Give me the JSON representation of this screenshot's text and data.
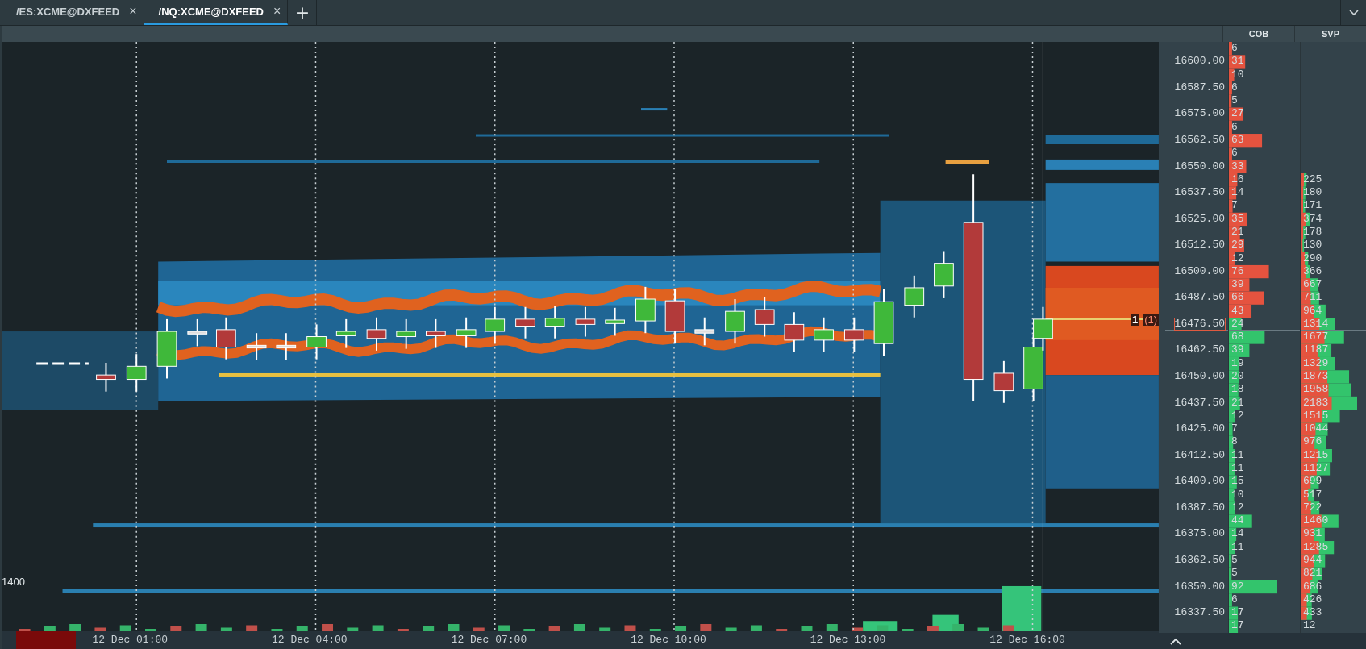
{
  "tabs": [
    {
      "label": "/ES:XCME@DXFEED",
      "close": "×",
      "selected": false
    },
    {
      "label": "/NQ:XCME@DXFEED",
      "close": "×",
      "selected": true
    }
  ],
  "new_tab": "+",
  "chart": {
    "y_label": "1400",
    "marker": "1",
    "marker_count": "(1)",
    "x_labels": [
      "12 Dec 01:00",
      "12 Dec 04:00",
      "12 Dec 07:00",
      "12 Dec 10:00",
      "12 Dec 13:00",
      "12 Dec 16:00"
    ]
  },
  "ladder": {
    "columns": [
      "COB",
      "SVP"
    ],
    "rows": [
      {
        "price": "",
        "cob": "6",
        "svp": "",
        "selected": false
      },
      {
        "price": "16600.00",
        "cob": "31",
        "svp": "",
        "selected": false
      },
      {
        "price": "",
        "cob": "10",
        "svp": "",
        "selected": false
      },
      {
        "price": "16587.50",
        "cob": "6",
        "svp": "",
        "selected": false
      },
      {
        "price": "",
        "cob": "5",
        "svp": "",
        "selected": false
      },
      {
        "price": "16575.00",
        "cob": "27",
        "svp": "",
        "selected": false
      },
      {
        "price": "",
        "cob": "6",
        "svp": "",
        "selected": false
      },
      {
        "price": "16562.50",
        "cob": "63",
        "svp": "",
        "selected": false
      },
      {
        "price": "",
        "cob": "6",
        "svp": "",
        "selected": false
      },
      {
        "price": "16550.00",
        "cob": "33",
        "svp": "",
        "selected": false
      },
      {
        "price": "",
        "cob": "16",
        "svp": "225",
        "selected": false
      },
      {
        "price": "16537.50",
        "cob": "14",
        "svp": "180",
        "selected": false
      },
      {
        "price": "",
        "cob": "7",
        "svp": "171",
        "selected": false
      },
      {
        "price": "16525.00",
        "cob": "35",
        "svp": "374",
        "selected": false
      },
      {
        "price": "",
        "cob": "21",
        "svp": "178",
        "selected": false
      },
      {
        "price": "16512.50",
        "cob": "29",
        "svp": "130",
        "selected": false
      },
      {
        "price": "",
        "cob": "12",
        "svp": "290",
        "selected": false
      },
      {
        "price": "16500.00",
        "cob": "76",
        "svp": "366",
        "selected": false
      },
      {
        "price": "",
        "cob": "39",
        "svp": "667",
        "selected": false
      },
      {
        "price": "16487.50",
        "cob": "66",
        "svp": "711",
        "selected": false
      },
      {
        "price": "",
        "cob": "43",
        "svp": "964",
        "selected": false
      },
      {
        "price": "16476.50",
        "cob": "24",
        "svp": "1314",
        "selected": true
      },
      {
        "price": "",
        "cob": "68",
        "svp": "1677",
        "selected": false
      },
      {
        "price": "16462.50",
        "cob": "39",
        "svp": "1187",
        "selected": false
      },
      {
        "price": "",
        "cob": "19",
        "svp": "1329",
        "selected": false
      },
      {
        "price": "16450.00",
        "cob": "20",
        "svp": "1873",
        "selected": false
      },
      {
        "price": "",
        "cob": "18",
        "svp": "1958",
        "selected": false
      },
      {
        "price": "16437.50",
        "cob": "21",
        "svp": "2183",
        "selected": false
      },
      {
        "price": "",
        "cob": "12",
        "svp": "1515",
        "selected": false
      },
      {
        "price": "16425.00",
        "cob": "7",
        "svp": "1044",
        "selected": false
      },
      {
        "price": "",
        "cob": "8",
        "svp": "976",
        "selected": false
      },
      {
        "price": "16412.50",
        "cob": "11",
        "svp": "1215",
        "selected": false
      },
      {
        "price": "",
        "cob": "11",
        "svp": "1127",
        "selected": false
      },
      {
        "price": "16400.00",
        "cob": "15",
        "svp": "699",
        "selected": false
      },
      {
        "price": "",
        "cob": "10",
        "svp": "517",
        "selected": false
      },
      {
        "price": "16387.50",
        "cob": "12",
        "svp": "722",
        "selected": false
      },
      {
        "price": "",
        "cob": "44",
        "svp": "1460",
        "selected": false
      },
      {
        "price": "16375.00",
        "cob": "14",
        "svp": "931",
        "selected": false
      },
      {
        "price": "",
        "cob": "11",
        "svp": "1285",
        "selected": false
      },
      {
        "price": "16362.50",
        "cob": "5",
        "svp": "944",
        "selected": false
      },
      {
        "price": "",
        "cob": "5",
        "svp": "821",
        "selected": false
      },
      {
        "price": "16350.00",
        "cob": "92",
        "svp": "686",
        "selected": false
      },
      {
        "price": "",
        "cob": "6",
        "svp": "426",
        "selected": false
      },
      {
        "price": "16337.50",
        "cob": "17",
        "svp": "433",
        "selected": false
      },
      {
        "price": "",
        "cob": "17",
        "svp": "12",
        "selected": false
      }
    ]
  }
}
